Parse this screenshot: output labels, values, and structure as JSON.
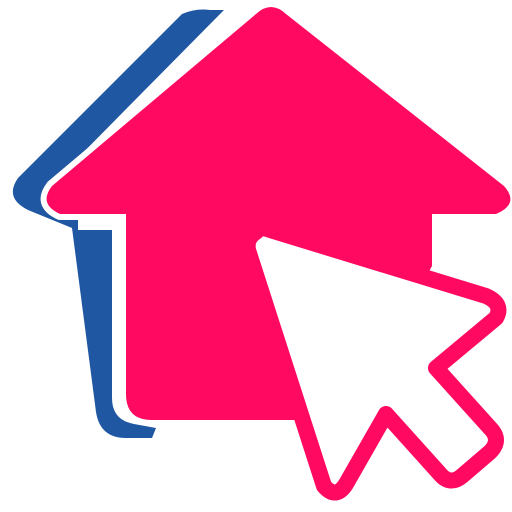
{
  "logo": {
    "icon": "home-click-icon",
    "colors": {
      "primary": "#ff0a60",
      "secondary": "#1f57a3",
      "background": "#ffffff",
      "outline": "#ffffff"
    }
  }
}
